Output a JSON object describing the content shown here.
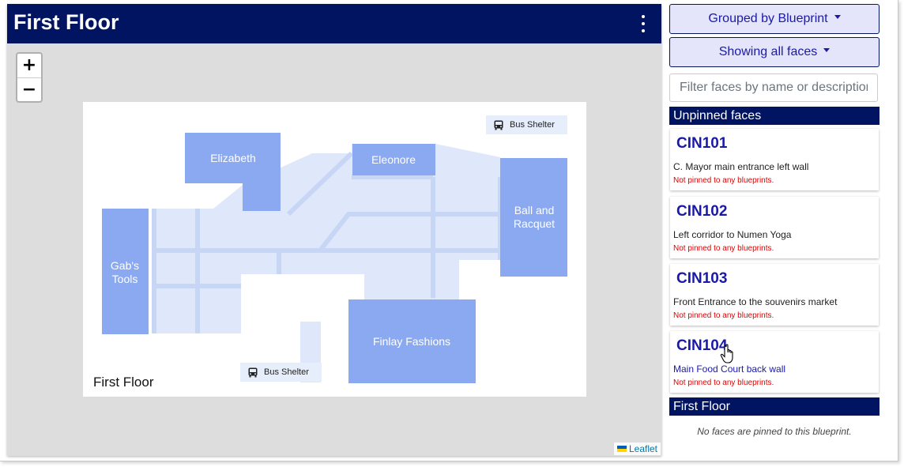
{
  "map": {
    "title": "First Floor",
    "menu_icon": "kebab-menu-icon",
    "zoom_in": "+",
    "zoom_out": "−",
    "attribution": "Leaflet"
  },
  "blueprint": {
    "label": "First Floor",
    "rooms": [
      {
        "name": "Elizabeth"
      },
      {
        "name": "Eleonore"
      },
      {
        "name": "Ball and",
        "name2": "Racquet"
      },
      {
        "name": "Gab's",
        "name2": "Tools"
      },
      {
        "name": "Finlay Fashions"
      }
    ],
    "bus_shelters": [
      "Bus Shelter",
      "Bus Shelter"
    ],
    "colors": {
      "room": "#8aa9f0",
      "corridor": "#dfe7fa",
      "corridor_line": "#c8d6f5"
    }
  },
  "sidebar": {
    "group_button": "Grouped by Blueprint",
    "show_button": "Showing all faces",
    "filter_placeholder": "Filter faces by name or description",
    "unpinned_heading": "Unpinned faces",
    "faces": [
      {
        "code": "CIN101",
        "description": "C. Mayor main entrance left wall",
        "note": "Not pinned to any blueprints."
      },
      {
        "code": "CIN102",
        "description": "Left corridor to Numen Yoga",
        "note": "Not pinned to any blueprints."
      },
      {
        "code": "CIN103",
        "description": "Front Entrance to the souvenirs market",
        "note": "Not pinned to any blueprints."
      },
      {
        "code": "CIN104",
        "description": "Main Food Court back wall",
        "note": "Not pinned to any blueprints."
      }
    ],
    "floor_heading": "First Floor",
    "floor_empty": "No faces are pinned to this blueprint."
  },
  "colors": {
    "header": "#001461",
    "accent": "#1a1aa8",
    "error": "#e00000"
  }
}
